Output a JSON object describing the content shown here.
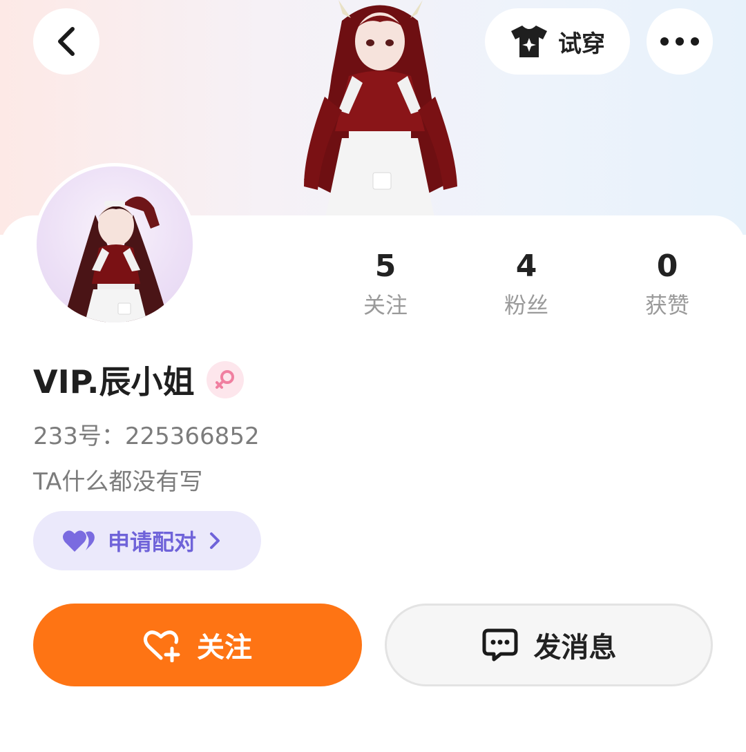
{
  "header": {
    "tryon_label": "试穿",
    "icons": [
      "back-icon",
      "tshirt-sparkle-icon",
      "more-icon"
    ]
  },
  "profile": {
    "name": "VIP.辰小姐",
    "gender_icon": "female-icon",
    "uid": "233号：225366852",
    "bio": "TA什么都没有写"
  },
  "stats": [
    {
      "value": "5",
      "label": "关注"
    },
    {
      "value": "4",
      "label": "粉丝"
    },
    {
      "value": "0",
      "label": "获赞"
    }
  ],
  "pair": {
    "label": "申请配对",
    "icon": "heart-pair-icon"
  },
  "actions": {
    "follow_label": "关注",
    "message_label": "发消息"
  },
  "colors": {
    "accent_orange": "#fe7414",
    "pair_purple": "#6f63d9",
    "pair_bg": "#ebe9fb",
    "female_pink": "#f07fa0"
  }
}
